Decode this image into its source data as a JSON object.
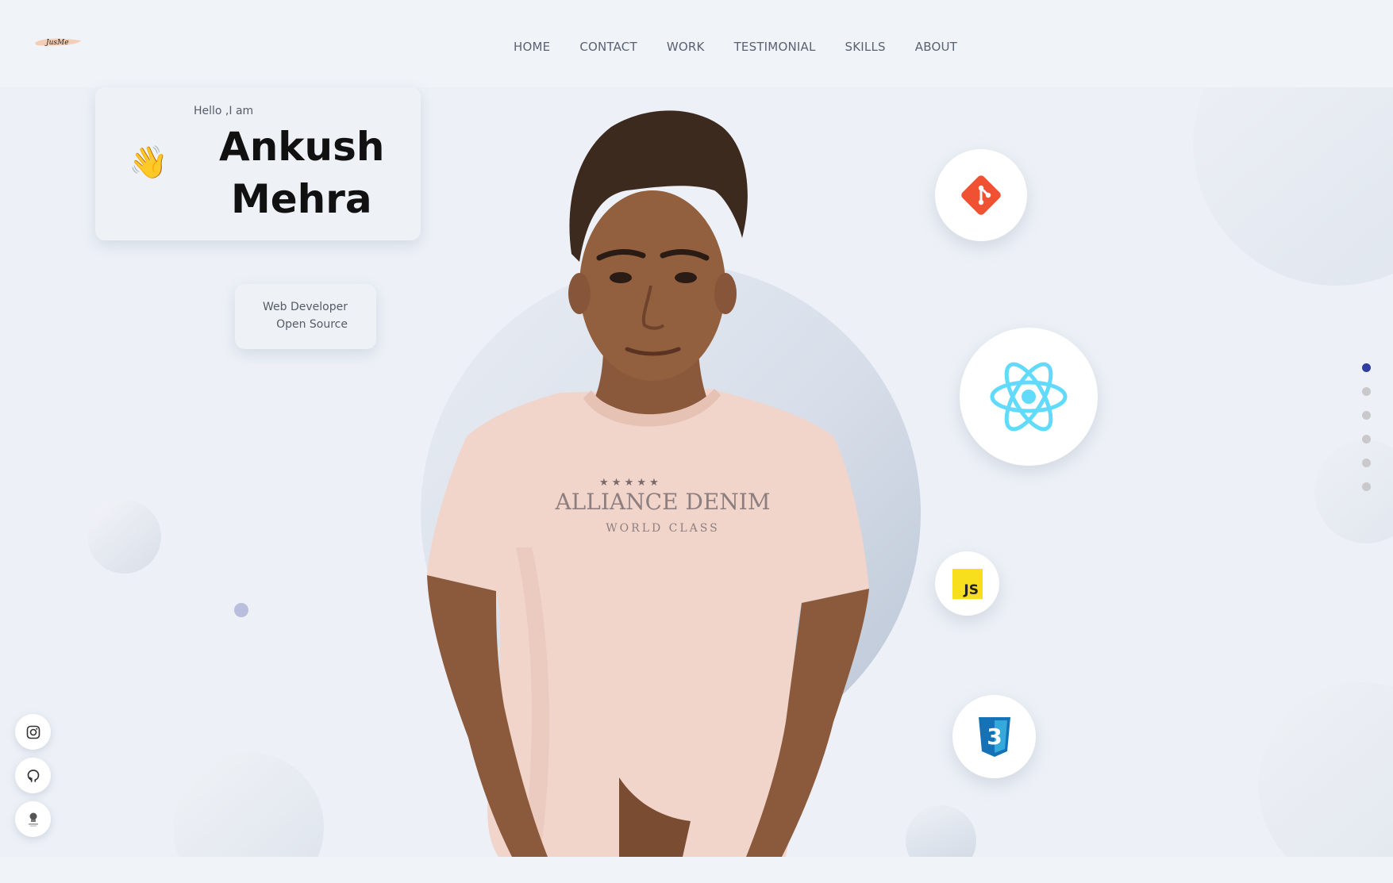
{
  "logo": {
    "text": "JusMe"
  },
  "nav": {
    "items": [
      {
        "label": "HOME"
      },
      {
        "label": "CONTACT"
      },
      {
        "label": "WORK"
      },
      {
        "label": "TESTIMONIAL"
      },
      {
        "label": "SKILLS"
      },
      {
        "label": "ABOUT"
      }
    ]
  },
  "intro": {
    "greeting": "Hello ,I am",
    "wave_emoji": "👋",
    "first_name": "Ankush",
    "last_name": "Mehra"
  },
  "role": {
    "line1": "Web Developer",
    "line2": "Open Source"
  },
  "shirt": {
    "line1": "ALLIANCE DENIM",
    "line2": "WORLD CLASS"
  },
  "skills": {
    "git_icon": "git-icon",
    "react_icon": "react-icon",
    "js_icon": "javascript-icon",
    "js_label": "JS",
    "css_icon": "css3-icon",
    "css_label": "3"
  },
  "pager": {
    "count": 6,
    "active_index": 0
  },
  "social": {
    "icons": [
      "instagram-icon",
      "github-icon",
      "geeksforgeeks-icon"
    ]
  },
  "colors": {
    "background": "#edf1f7",
    "pager_active": "#2f3f9e",
    "git": "#f05133",
    "react": "#61dafb",
    "js": "#f7df1e",
    "css": "#1572b6",
    "shirt": "#f1d4ca"
  }
}
